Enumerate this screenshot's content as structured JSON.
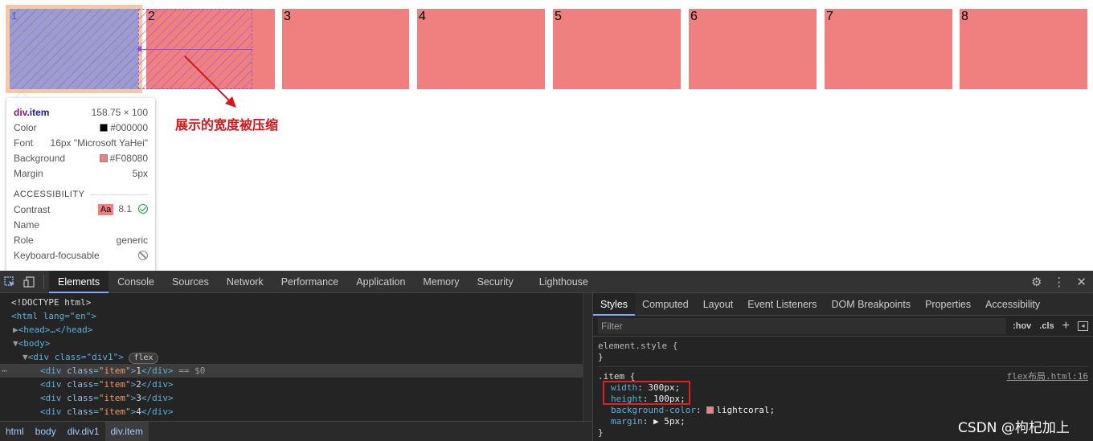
{
  "items": [
    {
      "label": "1"
    },
    {
      "label": "2"
    },
    {
      "label": "3"
    },
    {
      "label": "4"
    },
    {
      "label": "5"
    },
    {
      "label": "6"
    },
    {
      "label": "7"
    },
    {
      "label": "8"
    }
  ],
  "annotation": "展示的宽度被压缩",
  "tooltip": {
    "tag": "div",
    "cls": ".item",
    "dimensions": "158.75 × 100",
    "rows": {
      "color_label": "Color",
      "color_value": "#000000",
      "font_label": "Font",
      "font_value": "16px \"Microsoft YaHei\"",
      "background_label": "Background",
      "background_value": "#F08080",
      "margin_label": "Margin",
      "margin_value": "5px"
    },
    "accessibility": {
      "title": "ACCESSIBILITY",
      "contrast_label": "Contrast",
      "contrast_aa": "Aa",
      "contrast_value": "8.1",
      "name_label": "Name",
      "role_label": "Role",
      "role_value": "generic",
      "keyboard_label": "Keyboard-focusable"
    }
  },
  "devtools": {
    "tabs": [
      "Elements",
      "Console",
      "Sources",
      "Network",
      "Performance",
      "Application",
      "Memory",
      "Security",
      "Lighthouse"
    ],
    "active_tab": "Elements",
    "dom": {
      "doctype": "<!DOCTYPE html>",
      "html_open": "<html lang=\"en\">",
      "head": "<head>…</head>",
      "body_open": "<body>",
      "div_open": "<div class=\"div1\">",
      "flex_badge": "flex",
      "selected_suffix": "== $0",
      "children": [
        "1",
        "2",
        "3",
        "4"
      ]
    },
    "breadcrumbs": [
      "html",
      "body",
      "div.div1",
      "div.item"
    ],
    "styles_tabs": [
      "Styles",
      "Computed",
      "Layout",
      "Event Listeners",
      "DOM Breakpoints",
      "Properties",
      "Accessibility"
    ],
    "filter_placeholder": "Filter",
    "hov": ":hov",
    "cls": ".cls",
    "element_style": "element.style {",
    "close_brace": "}",
    "rule_selector": ".item {",
    "rule_source": "flex布局.html:16",
    "declarations": [
      {
        "prop": "width",
        "value": "300px;"
      },
      {
        "prop": "height",
        "value": "100px;"
      },
      {
        "prop": "background-color",
        "value": "lightcoral;"
      },
      {
        "prop": "margin",
        "value": "▶ 5px;"
      }
    ]
  },
  "watermark": "CSDN @枸杞加上",
  "colors": {
    "item": "#f08080",
    "highlight": "#9e9ccc",
    "annotation": "#d3171a"
  }
}
